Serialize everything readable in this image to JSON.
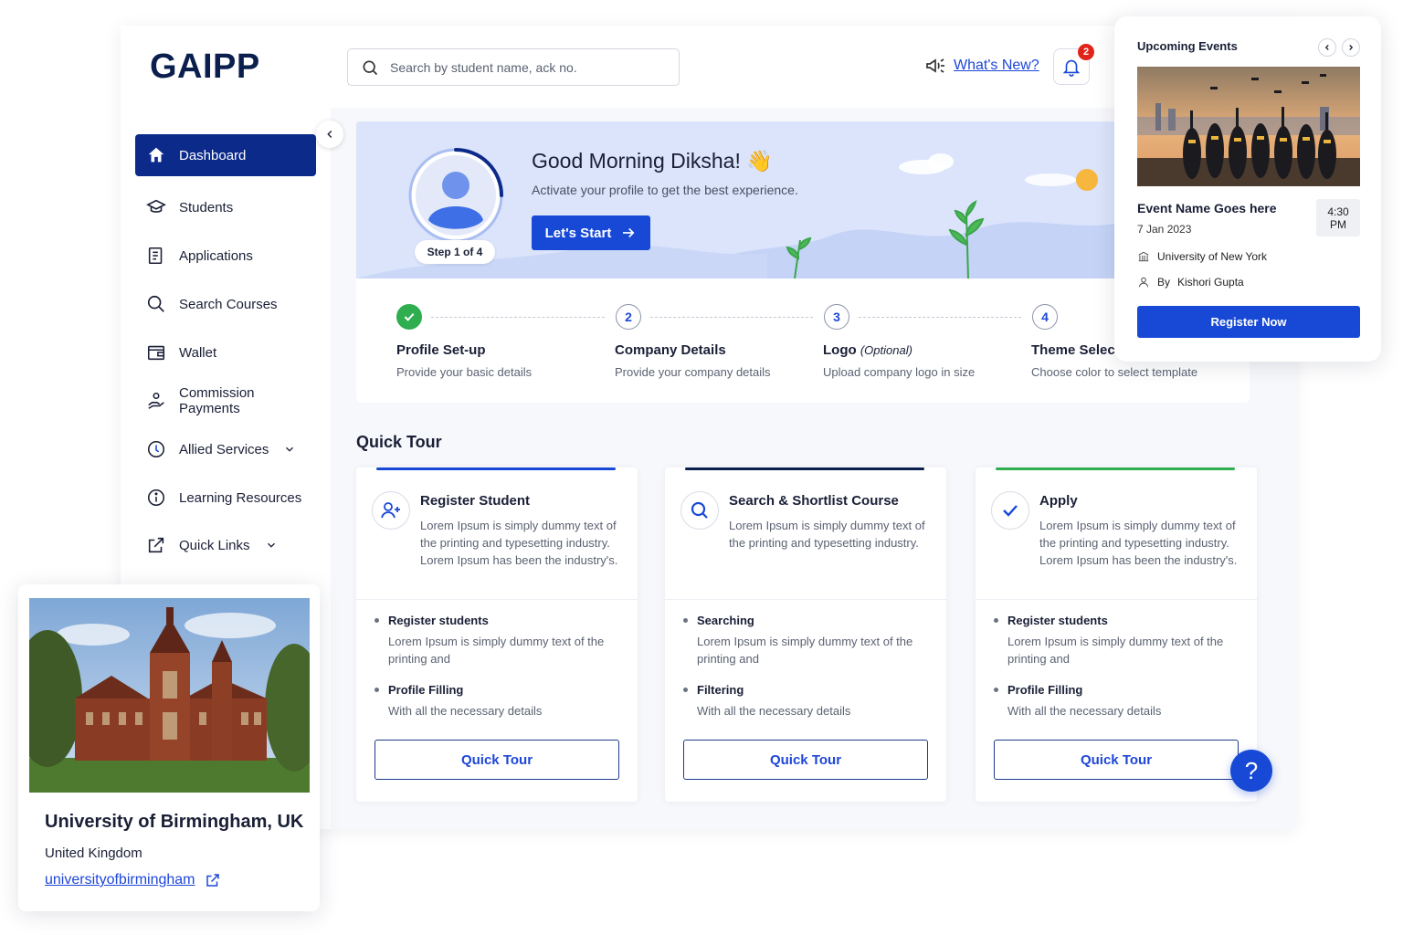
{
  "app": {
    "logo": "GAIPP"
  },
  "header": {
    "search_placeholder": "Search by student name, ack no.",
    "whats_new": "What's New?",
    "notification_count": "2"
  },
  "sidebar": {
    "items": [
      {
        "label": "Dashboard",
        "icon": "home-icon",
        "active": true
      },
      {
        "label": "Students",
        "icon": "graduation-cap-icon"
      },
      {
        "label": "Applications",
        "icon": "document-icon"
      },
      {
        "label": "Search Courses",
        "icon": "search-icon"
      },
      {
        "label": "Wallet",
        "icon": "wallet-icon"
      },
      {
        "label": "Commission Payments",
        "icon": "hand-coin-icon"
      },
      {
        "label": "Allied Services",
        "icon": "service-icon",
        "expandable": true
      },
      {
        "label": "Learning Resources",
        "icon": "info-icon"
      },
      {
        "label": "Quick Links",
        "icon": "external-link-icon",
        "expandable": true
      }
    ]
  },
  "welcome": {
    "greeting": "Good Morning Diksha! 👋",
    "subtitle": "Activate your profile to get the best experience.",
    "start_label": "Let's Start",
    "step_progress": "Step 1 of 4",
    "progress_fraction": 0.25
  },
  "steps": [
    {
      "number": "1",
      "title": "Profile Set-up",
      "optional": "",
      "desc": "Provide your basic details",
      "done": true
    },
    {
      "number": "2",
      "title": "Company Details",
      "optional": "",
      "desc": "Provide your company details",
      "done": false
    },
    {
      "number": "3",
      "title": "Logo",
      "optional": "(Optional)",
      "desc": "Upload company logo in size",
      "done": false
    },
    {
      "number": "4",
      "title": "Theme Selecti",
      "optional": "",
      "desc": "Choose color to select template",
      "done": false
    }
  ],
  "quick_tour": {
    "title": "Quick Tour",
    "cards": [
      {
        "title": "Register Student",
        "icon": "add-user-icon",
        "accent": "#1749d6",
        "desc": "Lorem Ipsum is simply dummy text of the printing and typesetting industry. Lorem Ipsum has been the industry's.",
        "bullets": [
          {
            "head": "Register students",
            "body": "Lorem Ipsum is simply dummy text of the printing and"
          },
          {
            "head": "Profile Filling",
            "body": "With all the necessary details"
          }
        ],
        "button": "Quick Tour"
      },
      {
        "title": "Search & Shortlist Course",
        "icon": "search-icon",
        "accent": "#0b1f4e",
        "desc": "Lorem Ipsum is simply dummy text of the printing and typesetting industry.",
        "bullets": [
          {
            "head": "Searching",
            "body": "Lorem Ipsum is simply dummy text of the printing and"
          },
          {
            "head": "Filtering",
            "body": "With all the necessary details"
          }
        ],
        "button": "Quick Tour"
      },
      {
        "title": "Apply",
        "icon": "check-icon",
        "accent": "#2eae4e",
        "desc": "Lorem Ipsum is simply dummy text of the printing and typesetting industry. Lorem Ipsum has been the industry's.",
        "bullets": [
          {
            "head": "Register students",
            "body": "Lorem Ipsum is simply dummy text of the printing and"
          },
          {
            "head": "Profile Filling",
            "body": "With all the necessary details"
          }
        ],
        "button": "Quick Tour"
      }
    ]
  },
  "help": {
    "label": "?"
  },
  "events": {
    "title": "Upcoming Events",
    "name": "Event Name Goes here",
    "date": "7 Jan 2023",
    "time_top": "4:30",
    "time_bottom": "PM",
    "venue": "University of New York",
    "by_prefix": "By",
    "organizer": "Kishori Gupta",
    "button": "Register Now"
  },
  "university": {
    "name": "University of Birmingham, UK",
    "country": "United Kingdom",
    "link": "universityofbirmingham"
  },
  "colors": {
    "primary": "#1749d6",
    "navy": "#0c2a8a",
    "success": "#2eae4e",
    "badge": "#e2231a"
  }
}
